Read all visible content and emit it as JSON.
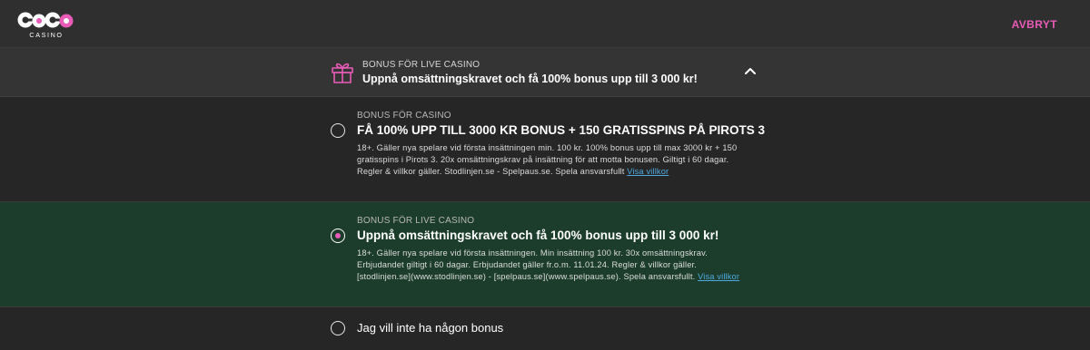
{
  "header": {
    "logo_text": "GOGO CASINO",
    "cancel_label": "AVBRYT",
    "accent_color": "#e85bb6"
  },
  "summary": {
    "category": "BONUS FÖR LIVE CASINO",
    "title": "Uppnå omsättningskravet och få 100% bonus upp till 3 000 kr!",
    "icon": "gift-icon",
    "toggle_icon": "chevron-up-icon"
  },
  "options": [
    {
      "category": "BONUS FÖR CASINO",
      "title": "FÅ 100% UPP TILL 3000 KR BONUS + 150 GRATISSPINS PÅ PIROTS 3",
      "terms": "18+. Gäller nya spelare vid första insättningen min. 100 kr. 100% bonus upp till max 3000 kr + 150 gratisspins i Pirots 3. 20x omsättningskrav på insättning för att motta bonusen. Giltigt i 60 dagar. Regler & villkor gäller. Stodlinjen.se - Spelpaus.se. Spela ansvarsfullt",
      "link": "Visa villkor",
      "selected": false
    },
    {
      "category": "BONUS FÖR LIVE CASINO",
      "title": "Uppnå omsättningskravet och få 100% bonus upp till 3 000 kr!",
      "terms": "18+. Gäller nya spelare vid första insättningen. Min insättning 100 kr. 30x omsättningskrav. Erbjudandet giltigt i 60 dagar. Erbjudandet gäller fr.o.m. 11.01.24. Regler & villkor gäller. [stodlinjen.se](www.stodlinjen.se) - [spelpaus.se](www.spelpaus.se). Spela ansvarsfullt.",
      "link": "Visa villkor",
      "selected": true
    },
    {
      "title": "Jag vill inte ha någon bonus",
      "selected": false
    }
  ],
  "colors": {
    "selected_bg": "#1c3d2c",
    "link": "#4fa9e0"
  }
}
